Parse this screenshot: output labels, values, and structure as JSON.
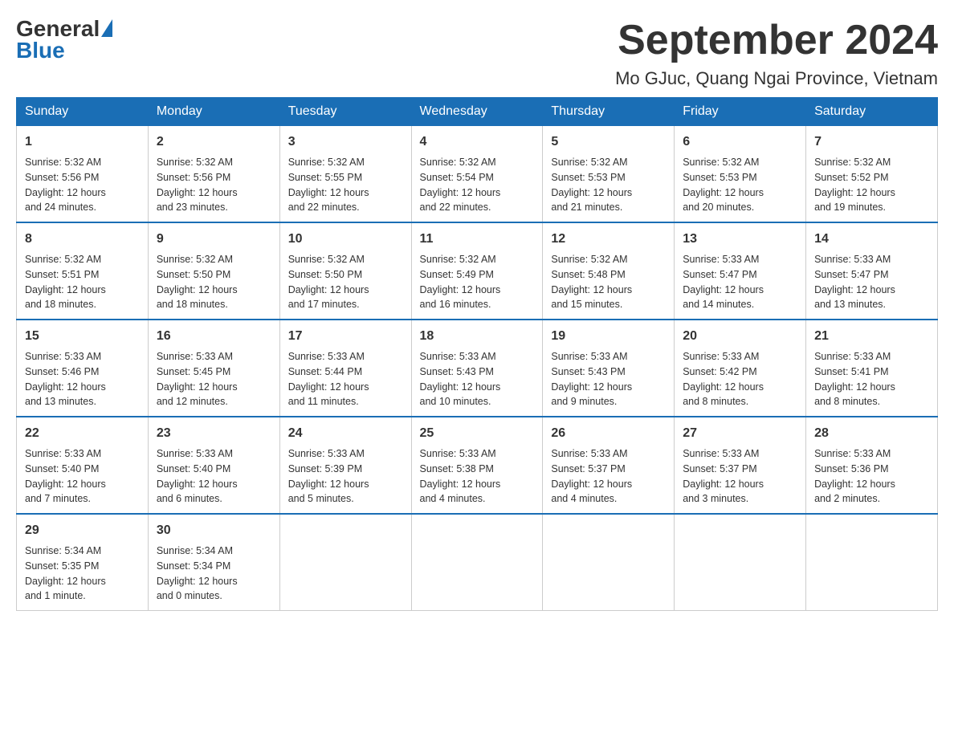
{
  "header": {
    "logo": {
      "general": "General",
      "blue": "Blue"
    },
    "title": "September 2024",
    "subtitle": "Mo GJuc, Quang Ngai Province, Vietnam"
  },
  "calendar": {
    "days": [
      "Sunday",
      "Monday",
      "Tuesday",
      "Wednesday",
      "Thursday",
      "Friday",
      "Saturday"
    ],
    "weeks": [
      [
        {
          "num": "1",
          "info": "Sunrise: 5:32 AM\nSunset: 5:56 PM\nDaylight: 12 hours\nand 24 minutes."
        },
        {
          "num": "2",
          "info": "Sunrise: 5:32 AM\nSunset: 5:56 PM\nDaylight: 12 hours\nand 23 minutes."
        },
        {
          "num": "3",
          "info": "Sunrise: 5:32 AM\nSunset: 5:55 PM\nDaylight: 12 hours\nand 22 minutes."
        },
        {
          "num": "4",
          "info": "Sunrise: 5:32 AM\nSunset: 5:54 PM\nDaylight: 12 hours\nand 22 minutes."
        },
        {
          "num": "5",
          "info": "Sunrise: 5:32 AM\nSunset: 5:53 PM\nDaylight: 12 hours\nand 21 minutes."
        },
        {
          "num": "6",
          "info": "Sunrise: 5:32 AM\nSunset: 5:53 PM\nDaylight: 12 hours\nand 20 minutes."
        },
        {
          "num": "7",
          "info": "Sunrise: 5:32 AM\nSunset: 5:52 PM\nDaylight: 12 hours\nand 19 minutes."
        }
      ],
      [
        {
          "num": "8",
          "info": "Sunrise: 5:32 AM\nSunset: 5:51 PM\nDaylight: 12 hours\nand 18 minutes."
        },
        {
          "num": "9",
          "info": "Sunrise: 5:32 AM\nSunset: 5:50 PM\nDaylight: 12 hours\nand 18 minutes."
        },
        {
          "num": "10",
          "info": "Sunrise: 5:32 AM\nSunset: 5:50 PM\nDaylight: 12 hours\nand 17 minutes."
        },
        {
          "num": "11",
          "info": "Sunrise: 5:32 AM\nSunset: 5:49 PM\nDaylight: 12 hours\nand 16 minutes."
        },
        {
          "num": "12",
          "info": "Sunrise: 5:32 AM\nSunset: 5:48 PM\nDaylight: 12 hours\nand 15 minutes."
        },
        {
          "num": "13",
          "info": "Sunrise: 5:33 AM\nSunset: 5:47 PM\nDaylight: 12 hours\nand 14 minutes."
        },
        {
          "num": "14",
          "info": "Sunrise: 5:33 AM\nSunset: 5:47 PM\nDaylight: 12 hours\nand 13 minutes."
        }
      ],
      [
        {
          "num": "15",
          "info": "Sunrise: 5:33 AM\nSunset: 5:46 PM\nDaylight: 12 hours\nand 13 minutes."
        },
        {
          "num": "16",
          "info": "Sunrise: 5:33 AM\nSunset: 5:45 PM\nDaylight: 12 hours\nand 12 minutes."
        },
        {
          "num": "17",
          "info": "Sunrise: 5:33 AM\nSunset: 5:44 PM\nDaylight: 12 hours\nand 11 minutes."
        },
        {
          "num": "18",
          "info": "Sunrise: 5:33 AM\nSunset: 5:43 PM\nDaylight: 12 hours\nand 10 minutes."
        },
        {
          "num": "19",
          "info": "Sunrise: 5:33 AM\nSunset: 5:43 PM\nDaylight: 12 hours\nand 9 minutes."
        },
        {
          "num": "20",
          "info": "Sunrise: 5:33 AM\nSunset: 5:42 PM\nDaylight: 12 hours\nand 8 minutes."
        },
        {
          "num": "21",
          "info": "Sunrise: 5:33 AM\nSunset: 5:41 PM\nDaylight: 12 hours\nand 8 minutes."
        }
      ],
      [
        {
          "num": "22",
          "info": "Sunrise: 5:33 AM\nSunset: 5:40 PM\nDaylight: 12 hours\nand 7 minutes."
        },
        {
          "num": "23",
          "info": "Sunrise: 5:33 AM\nSunset: 5:40 PM\nDaylight: 12 hours\nand 6 minutes."
        },
        {
          "num": "24",
          "info": "Sunrise: 5:33 AM\nSunset: 5:39 PM\nDaylight: 12 hours\nand 5 minutes."
        },
        {
          "num": "25",
          "info": "Sunrise: 5:33 AM\nSunset: 5:38 PM\nDaylight: 12 hours\nand 4 minutes."
        },
        {
          "num": "26",
          "info": "Sunrise: 5:33 AM\nSunset: 5:37 PM\nDaylight: 12 hours\nand 4 minutes."
        },
        {
          "num": "27",
          "info": "Sunrise: 5:33 AM\nSunset: 5:37 PM\nDaylight: 12 hours\nand 3 minutes."
        },
        {
          "num": "28",
          "info": "Sunrise: 5:33 AM\nSunset: 5:36 PM\nDaylight: 12 hours\nand 2 minutes."
        }
      ],
      [
        {
          "num": "29",
          "info": "Sunrise: 5:34 AM\nSunset: 5:35 PM\nDaylight: 12 hours\nand 1 minute."
        },
        {
          "num": "30",
          "info": "Sunrise: 5:34 AM\nSunset: 5:34 PM\nDaylight: 12 hours\nand 0 minutes."
        },
        null,
        null,
        null,
        null,
        null
      ]
    ]
  }
}
